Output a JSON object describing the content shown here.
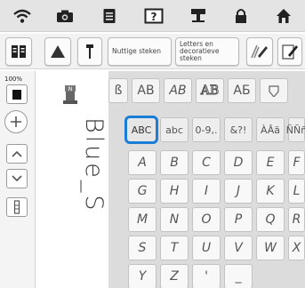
{
  "topbar": {
    "icons": [
      "wifi-icon",
      "camera-icon",
      "document-icon",
      "help-icon",
      "needle-icon",
      "lock-icon",
      "home-icon"
    ]
  },
  "toolbar": {
    "buttons": [
      {
        "name": "book-icon"
      },
      {
        "name": "triangle-icon"
      },
      {
        "name": "needle-single-icon"
      },
      {
        "label": "Nuttige steken"
      },
      {
        "label": "Letters en decoratieve steken"
      },
      {
        "name": "edit-pencil-icon"
      },
      {
        "name": "edit-document-icon"
      }
    ]
  },
  "left_panel": {
    "zoom": "100%"
  },
  "preview": {
    "text": "Blue_S"
  },
  "font_tabs": [
    "ß",
    "AB",
    "AB",
    "AB",
    "AБ"
  ],
  "char_sets": [
    "ABC",
    "abc",
    "0-9,.",
    "&?!",
    "ÀÂä",
    "ÑÑñ"
  ],
  "rows": [
    [
      "A",
      "B",
      "C",
      "D",
      "E",
      "F"
    ],
    [
      "G",
      "H",
      "I",
      "J",
      "K",
      "L"
    ],
    [
      "M",
      "N",
      "O",
      "P",
      "Q",
      "R"
    ],
    [
      "S",
      "T",
      "U",
      "V",
      "W",
      "X"
    ],
    [
      "Y",
      "Z",
      "'",
      "_"
    ]
  ],
  "colors": {
    "selection": "#1a7ed6"
  }
}
